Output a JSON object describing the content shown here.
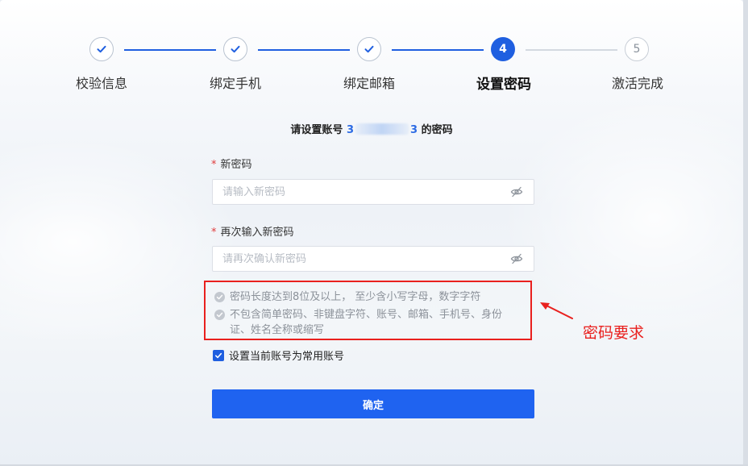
{
  "steps": [
    {
      "index": "1",
      "label": "校验信息",
      "state": "done"
    },
    {
      "index": "2",
      "label": "绑定手机",
      "state": "done"
    },
    {
      "index": "3",
      "label": "绑定邮箱",
      "state": "done"
    },
    {
      "index": "4",
      "label": "设置密码",
      "state": "active"
    },
    {
      "index": "5",
      "label": "激活完成",
      "state": "todo"
    }
  ],
  "title": {
    "prefix": "请设置账号",
    "account_start": "3",
    "account_end": "3",
    "suffix": "的密码"
  },
  "new_password": {
    "required_mark": "*",
    "label": "新密码",
    "placeholder": "请输入新密码"
  },
  "confirm_password": {
    "required_mark": "*",
    "label": "再次输入新密码",
    "placeholder": "请再次确认新密码"
  },
  "rules": [
    "密码长度达到8位及以上， 至少含小写字母，数字字符",
    "不包含简单密码、非键盘字符、账号、邮箱、手机号、身份证、姓名全称或缩写"
  ],
  "remember": {
    "label": "设置当前账号为常用账号",
    "checked": true
  },
  "submit_label": "确定",
  "annotation": "密码要求",
  "colors": {
    "primary": "#1f5fe0",
    "annotation": "#e9201e"
  }
}
